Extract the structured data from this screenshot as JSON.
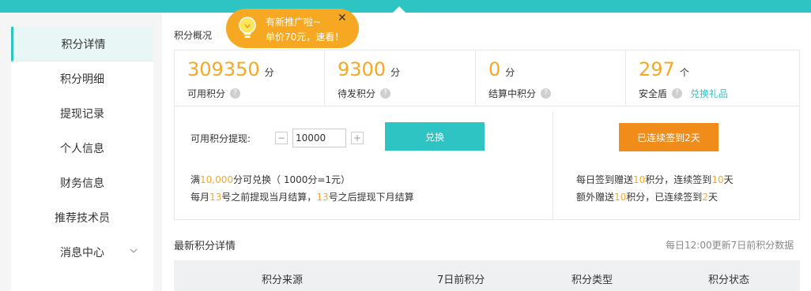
{
  "sidebar": {
    "items": [
      {
        "label": "积分详情",
        "active": true
      },
      {
        "label": "积分明细"
      },
      {
        "label": "提现记录"
      },
      {
        "label": "个人信息"
      },
      {
        "label": "财务信息"
      },
      {
        "label": "推荐技术员"
      },
      {
        "label": "消息中心",
        "expandable": true
      }
    ]
  },
  "tip": {
    "line1": "有新推广啦~",
    "line2": "单价70元，速看！",
    "close": "✕"
  },
  "overview": {
    "title": "积分概况",
    "stats": [
      {
        "value": "309350",
        "unit": "分",
        "label": "可用积分"
      },
      {
        "value": "9300",
        "unit": "分",
        "label": "待发积分"
      },
      {
        "value": "0",
        "unit": "分",
        "label": "结算中积分"
      },
      {
        "value": "297",
        "unit": "个",
        "label": "安全盾",
        "link": "兑换礼品"
      }
    ],
    "help_glyph": "?"
  },
  "withdraw": {
    "label": "可用积分提现:",
    "minus": "−",
    "plus": "+",
    "amount": "10000",
    "button": "兑换",
    "rule1_pre": "满",
    "rule1_num": "10,000",
    "rule1_post": "分可兑换（ 1000分=1元）",
    "rule2_a": "每月",
    "rule2_n1": "13",
    "rule2_b": "号之前提现当月结算，",
    "rule2_n2": "13",
    "rule2_c": "号之后提现下月结算"
  },
  "signin": {
    "button": "已连续签到2天",
    "rule1_a": "每日签到赠送",
    "rule1_n1": "10",
    "rule1_b": "积分，连续签到",
    "rule1_n2": "10",
    "rule1_c": "天",
    "rule2_a": "额外赠送",
    "rule2_n1": "10",
    "rule2_b": "积分，已连续签到",
    "rule2_n2": "2",
    "rule2_c": "天"
  },
  "details": {
    "title": "最新积分详情",
    "note": "每日12:00更新7日前积分数据",
    "columns": [
      "积分来源",
      "7日前积分",
      "积分类型",
      "积分状态"
    ]
  },
  "colors": {
    "accent": "#2ec4c4",
    "orange": "#f7a823",
    "signin": "#f08c1a"
  }
}
